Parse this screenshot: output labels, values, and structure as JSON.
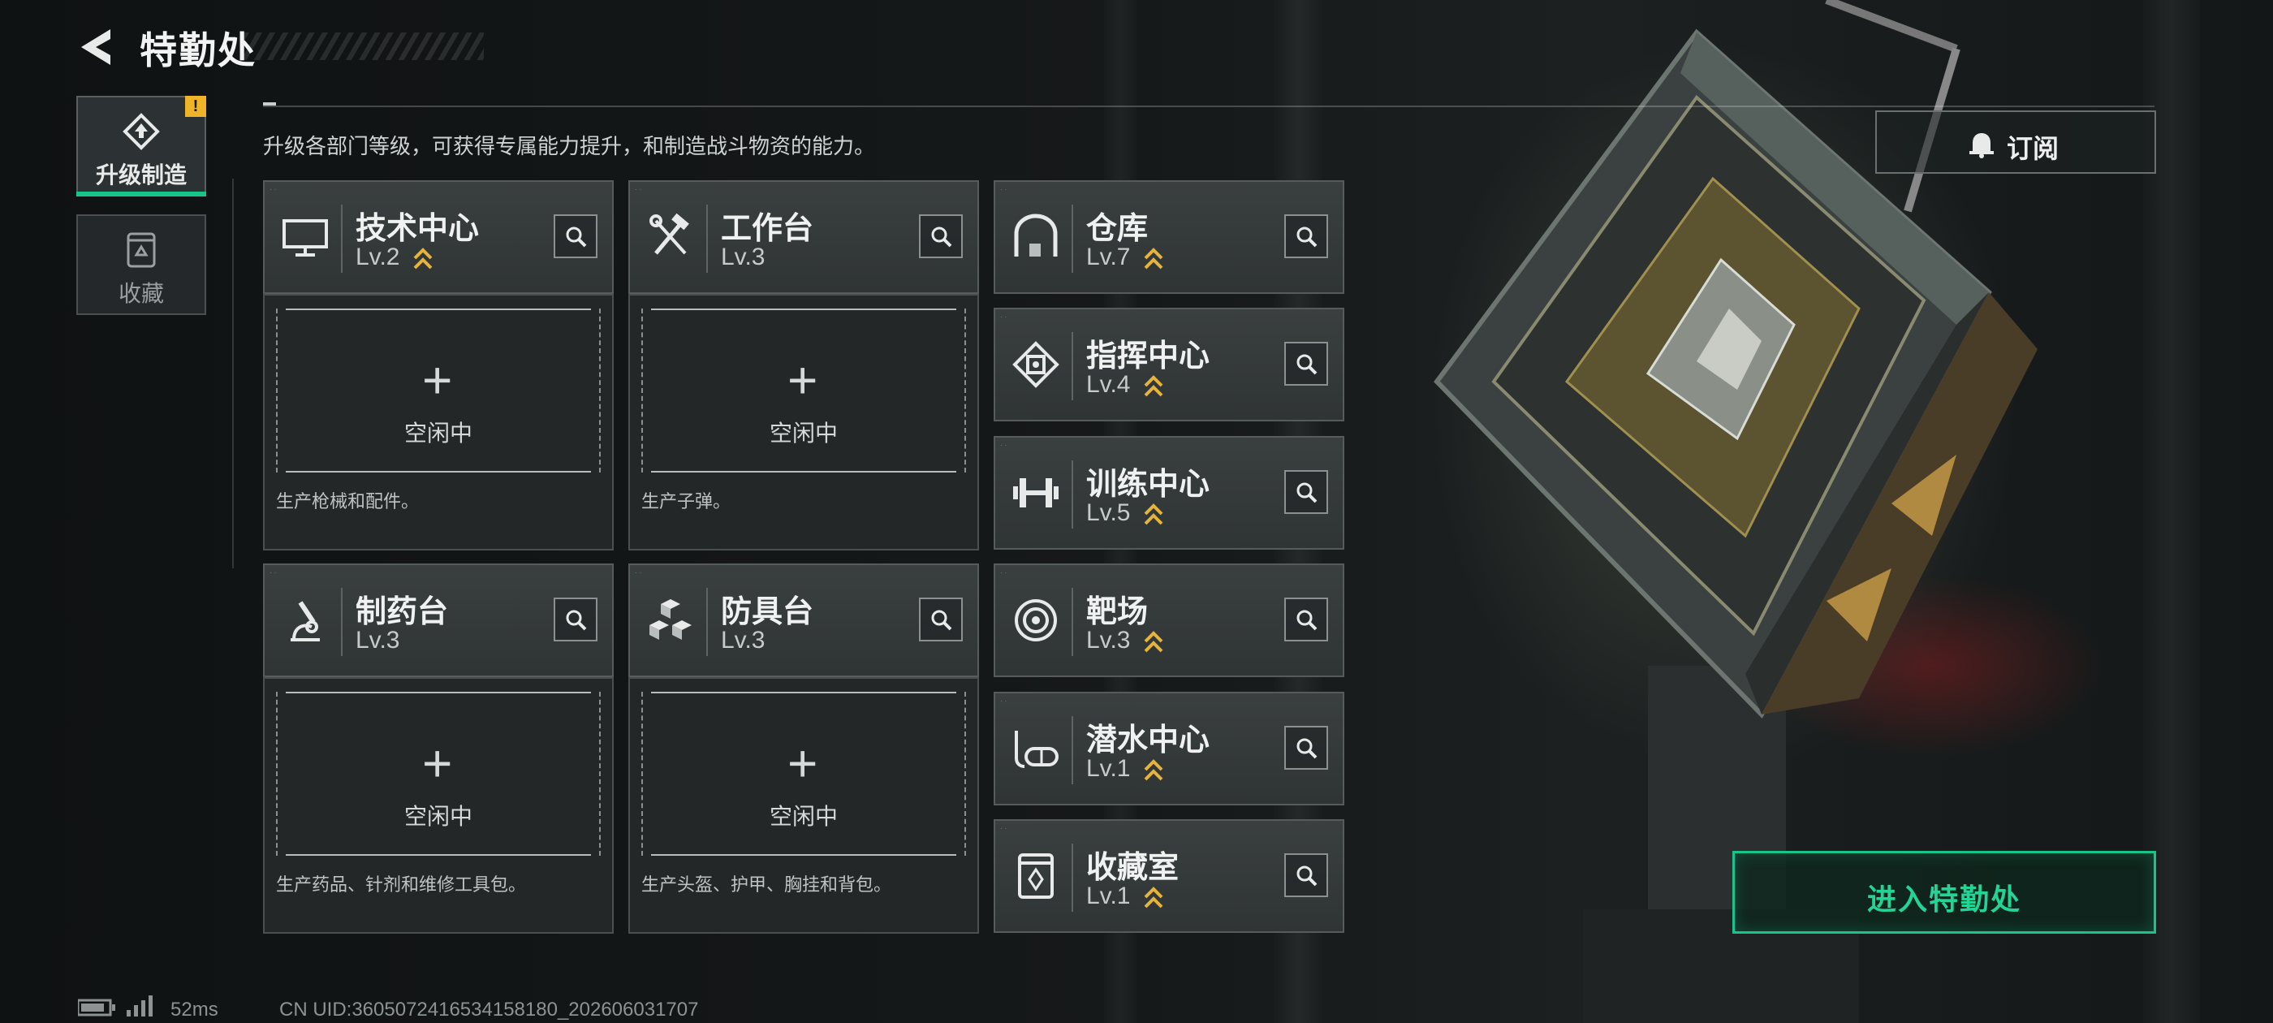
{
  "header": {
    "title": "特勤处",
    "back_icon": "back-arrow-icon"
  },
  "sidebar": {
    "tabs": [
      {
        "label": "升级制造",
        "icon": "upgrade-diamond-icon",
        "active": true,
        "alert": "!"
      },
      {
        "label": "收藏",
        "icon": "collection-trash-icon",
        "active": false
      }
    ]
  },
  "main": {
    "subtitle": "升级各部门等级，可获得专属能力提升，和制造战斗物资的能力。",
    "production_cards": [
      {
        "name": "技术中心",
        "level": "Lv.2",
        "upgradable": true,
        "icon": "monitor-icon",
        "slot_status": "空闲中",
        "slot_desc": "生产枪械和配件。"
      },
      {
        "name": "工作台",
        "level": "Lv.3",
        "upgradable": false,
        "icon": "hammer-wrench-icon",
        "slot_status": "空闲中",
        "slot_desc": "生产子弹。"
      },
      {
        "name": "制药台",
        "level": "Lv.3",
        "upgradable": false,
        "icon": "microscope-icon",
        "slot_status": "空闲中",
        "slot_desc": "生产药品、针剂和维修工具包。"
      },
      {
        "name": "防具台",
        "level": "Lv.3",
        "upgradable": false,
        "icon": "cubes-icon",
        "slot_status": "空闲中",
        "slot_desc": "生产头盔、护甲、胸挂和背包。"
      }
    ],
    "facility_cards": [
      {
        "name": "仓库",
        "level": "Lv.7",
        "upgradable": true,
        "icon": "warehouse-icon"
      },
      {
        "name": "指挥中心",
        "level": "Lv.4",
        "upgradable": true,
        "icon": "chip-icon"
      },
      {
        "name": "训练中心",
        "level": "Lv.5",
        "upgradable": true,
        "icon": "dumbbell-icon"
      },
      {
        "name": "靶场",
        "level": "Lv.3",
        "upgradable": true,
        "icon": "target-icon"
      },
      {
        "name": "潜水中心",
        "level": "Lv.1",
        "upgradable": true,
        "icon": "diving-mask-icon"
      },
      {
        "name": "收藏室",
        "level": "Lv.1",
        "upgradable": true,
        "icon": "display-case-icon"
      }
    ]
  },
  "actions": {
    "subscribe_label": "订阅",
    "enter_label": "进入特勤处"
  },
  "footer": {
    "ping": "52ms",
    "uid": "CN UID:3605072416534158180_202606031707"
  },
  "colors": {
    "accent_green": "#18c48a",
    "upgrade_gold": "#e6b43c",
    "alert_yellow": "#f0b428"
  }
}
